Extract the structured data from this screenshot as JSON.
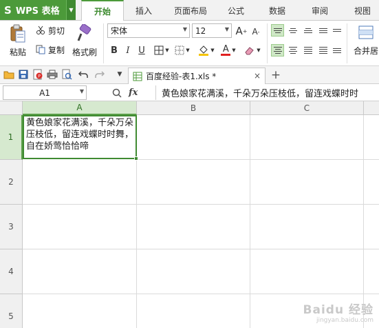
{
  "app": {
    "name": "WPS 表格",
    "logo": "S",
    "accent_color": "#4c9a3a"
  },
  "tabs": [
    {
      "label": "开始",
      "active": true
    },
    {
      "label": "插入",
      "active": false
    },
    {
      "label": "页面布局",
      "active": false
    },
    {
      "label": "公式",
      "active": false
    },
    {
      "label": "数据",
      "active": false
    },
    {
      "label": "审阅",
      "active": false
    },
    {
      "label": "视图",
      "active": false
    }
  ],
  "ribbon": {
    "paste_label": "粘贴",
    "cut_label": "剪切",
    "copy_label": "复制",
    "format_painter_label": "格式刷",
    "font_name": "宋体",
    "font_size": "12",
    "bold": "B",
    "italic": "I",
    "underline": "U",
    "grow_font": "A",
    "shrink_font": "A",
    "font_color_glyph": "A",
    "merge_center_label": "合并居"
  },
  "file_tab": {
    "name": "百度经验-表1.xls *",
    "close": "×"
  },
  "new_tab": "+",
  "formula_bar": {
    "cell_ref": "A1",
    "fx": "fx",
    "content": "黄色娘家花满溪，千朵万朵压枝低，留连戏蝶时时"
  },
  "grid": {
    "columns": [
      "A",
      "B",
      "C"
    ],
    "rows": [
      "1",
      "2",
      "3",
      "4",
      "5"
    ],
    "selected_column": "A",
    "selected_row": "1",
    "cell_a1": "黄色娘家花满溪，千朵万朵压枝低，留连戏蝶时时舞，自在娇莺恰恰啼"
  },
  "watermark": {
    "brand": "Baidu 经验",
    "url": "jingyan.baidu.com"
  }
}
